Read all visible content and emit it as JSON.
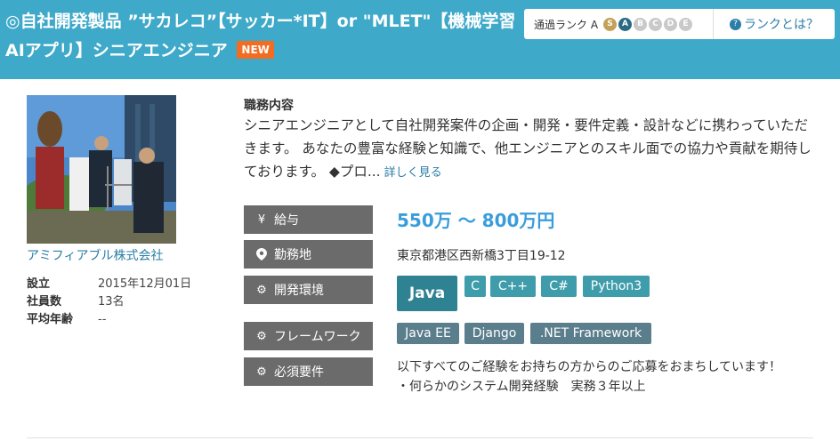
{
  "header": {
    "title": "◎自社開発製品 ”サカレコ”【サッカー*IT】or \"MLET\"【機械学習AIアプリ】シニアエンジニア",
    "new_badge": "NEW",
    "rank_label": "通過ランク A",
    "rank_letters": [
      "S",
      "A",
      "B",
      "C",
      "D",
      "E"
    ],
    "rank_help_link": "ランクとは？"
  },
  "company": {
    "photo": "company-photo",
    "name": "アミフィアブル株式会社",
    "info": [
      {
        "key": "設立",
        "value": "2015年12月01日"
      },
      {
        "key": "社員数",
        "value": "13名"
      },
      {
        "key": "平均年齢",
        "value": "--"
      }
    ]
  },
  "job": {
    "desc_heading": "職務内容",
    "desc_text": "シニアエンジニアとして自社開発案件の企画・開発・要件定義・設計などに携わっていただきます。 あなたの豊富な経験と知識で、他エンジニアとのスキル面での協力や貢献を期待しております。 ◆プロ...",
    "more_link": "詳しく見る",
    "salary_label": "給与",
    "salary": "550万 〜 800万円",
    "location_label": "勤務地",
    "location": "東京都港区西新橋3丁目19-12",
    "dev_env_label": "開発環境",
    "dev_env": [
      "Java",
      "C",
      "C++",
      "C#",
      "Python3"
    ],
    "framework_label": "フレームワーク",
    "frameworks": [
      "Java EE",
      "Django",
      ".NET Framework"
    ],
    "requirements_label": "必須要件",
    "requirements_line1": "以下すべてのご経験をお持ちの方からのご応募をおまちしています！",
    "requirements_line2": "・何らかのシステム開発経験　実務３年以上"
  },
  "colors": {
    "header_bg": "#3fa9c9",
    "new_badge": "#f26c21",
    "link": "#2a7ea7",
    "salary": "#3a9ddb",
    "label_bg": "#6b6b6b",
    "tag": "#3f9dab",
    "tag_primary": "#2f8291",
    "tag_framework": "#5b7e8d"
  },
  "icons": {
    "salary": "yen-icon",
    "location": "map-pin-icon",
    "dev_env": "gear-icon",
    "framework": "gear-icon",
    "requirements": "gear-icon",
    "rank_help": "question-circle-icon"
  }
}
